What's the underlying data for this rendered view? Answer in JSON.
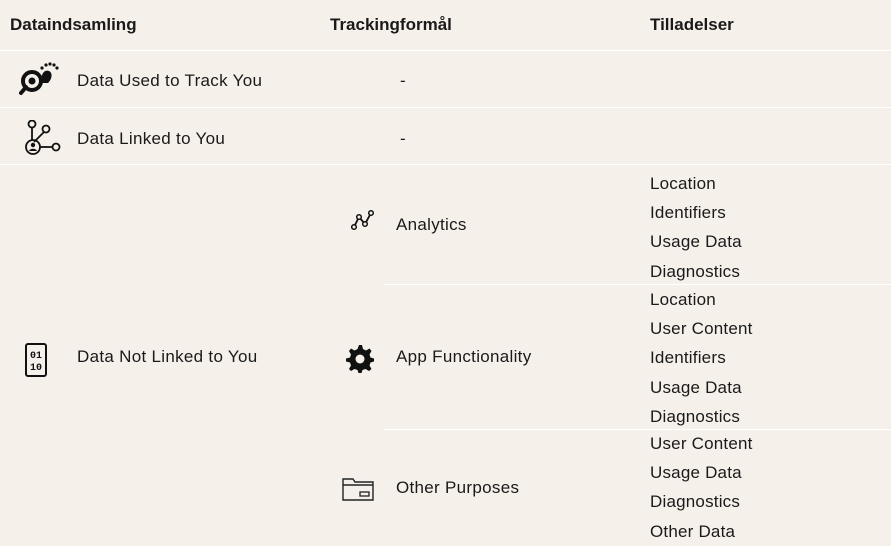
{
  "headers": {
    "col1": "Dataindsamling",
    "col2": "Trackingformål",
    "col3": "Tilladelser"
  },
  "rows": [
    {
      "category": "Data Used to Track You",
      "icon": "footprint-magnifier-icon",
      "purpose": "-"
    },
    {
      "category": "Data Linked to You",
      "icon": "person-network-icon",
      "purpose": "-"
    },
    {
      "category": "Data Not Linked to You",
      "icon": "binary-data-icon",
      "groups": [
        {
          "purpose": "Analytics",
          "icon": "analytics-line-icon",
          "permissions": [
            "Location",
            "Identifiers",
            "Usage Data",
            "Diagnostics"
          ]
        },
        {
          "purpose": "App Functionality",
          "icon": "gear-icon",
          "permissions": [
            "Location",
            "User Content",
            "Identifiers",
            "Usage Data",
            "Diagnostics"
          ]
        },
        {
          "purpose": "Other Purposes",
          "icon": "folder-icon",
          "permissions": [
            "User Content",
            "Usage Data",
            "Diagnostics",
            "Other Data"
          ]
        }
      ]
    }
  ]
}
